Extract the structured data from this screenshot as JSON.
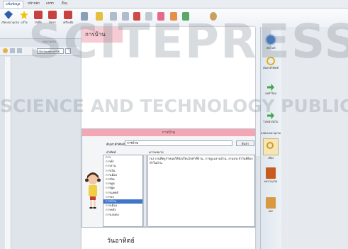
{
  "tabs": [
    "แฟ้มข้อมูล",
    "หน้าหลัก",
    "แทรก",
    "อื่นๆ"
  ],
  "ribbon": {
    "buttons": [
      "เปิดพจนานุกรม",
      "แก้ไข",
      "บันทึก",
      "ค้นหา",
      "เครื่องมือ"
    ],
    "group_label": "พจนานุกรม"
  },
  "format_bar": {
    "font": "TH SarabunPSK",
    "size": "14"
  },
  "document": {
    "heading": "การบ้าน",
    "word": "วันอาทิตย์"
  },
  "dictionary": {
    "title": "การบ้าน",
    "search_label": "ค้นหาคำศัพท์:",
    "search_value": "การบ้าน",
    "search_button": "ค้นหา",
    "col_word": "คำศัพท์",
    "col_meaning": "ความหมาย",
    "words": [
      "การ",
      "การค้า",
      "การงาน",
      "การเงิน",
      "การเมือง",
      "การบิน",
      "การทูต",
      "การพูด",
      "การแพทย์",
      "การรถ",
      "การบ้าน",
      "การเมือง",
      "การคลัง",
      "การเกษตร"
    ],
    "selected_index": 10,
    "meaning": "(น) งานที่ครูกำหนดให้นักเรียนไปทำที่บ้าน, การดูแลงานบ้าน, งานประจำวันที่ต้องทำในบ้าน"
  },
  "right_panel": {
    "items": [
      "เปิดไฟล์",
      "ค้นหาคำศัพท์",
      "ลงคำใหม่",
      "ไปหน้าถัดไป",
      "แสดงพจนานุกรม",
      "เสียง",
      "พจนานุกรม",
      "ออก"
    ]
  },
  "watermark": {
    "line1": "SCITEPRESS",
    "line2": "SCIENCE AND TECHNOLOGY PUBLICATIONS"
  },
  "colors": {
    "accent": "#f3a6b4",
    "heading_bg": "#f7cbd3",
    "selection": "#3f76c9"
  }
}
